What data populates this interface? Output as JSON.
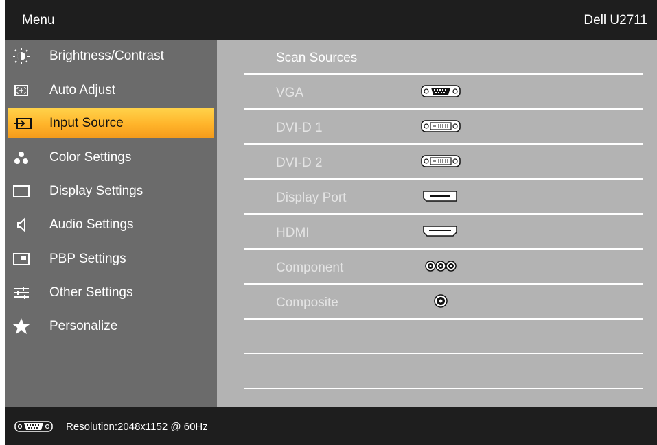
{
  "header": {
    "title": "Menu",
    "model": "Dell U2711"
  },
  "sidebar": {
    "items": [
      {
        "label": "Brightness/Contrast",
        "icon": "brightness-icon"
      },
      {
        "label": "Auto Adjust",
        "icon": "auto-adjust-icon"
      },
      {
        "label": "Input Source",
        "icon": "input-source-icon",
        "selected": true
      },
      {
        "label": "Color Settings",
        "icon": "color-settings-icon"
      },
      {
        "label": "Display Settings",
        "icon": "display-settings-icon"
      },
      {
        "label": "Audio Settings",
        "icon": "speaker-icon"
      },
      {
        "label": "PBP Settings",
        "icon": "pbp-icon"
      },
      {
        "label": "Other Settings",
        "icon": "sliders-icon"
      },
      {
        "label": "Personalize",
        "icon": "star-icon"
      }
    ]
  },
  "main": {
    "rows": [
      {
        "label": "Scan Sources",
        "connector": ""
      },
      {
        "label": "VGA",
        "connector": "vga-connector-icon"
      },
      {
        "label": "DVI-D 1",
        "connector": "dvi-connector-icon"
      },
      {
        "label": "DVI-D 2",
        "connector": "dvi-connector-icon"
      },
      {
        "label": "Display Port",
        "connector": "displayport-connector-icon"
      },
      {
        "label": "HDMI",
        "connector": "hdmi-connector-icon"
      },
      {
        "label": "Component",
        "connector": "component-connector-icon"
      },
      {
        "label": "Composite",
        "connector": "composite-connector-icon"
      }
    ]
  },
  "footer": {
    "resolution": "Resolution:2048x1152 @ 60Hz",
    "connector": "vga-connector-icon"
  },
  "colors": {
    "highlight": "#ffb42a",
    "sidebar": "#6b6b6b",
    "content": "#b3b3b3",
    "frame": "#1e1e1e"
  }
}
